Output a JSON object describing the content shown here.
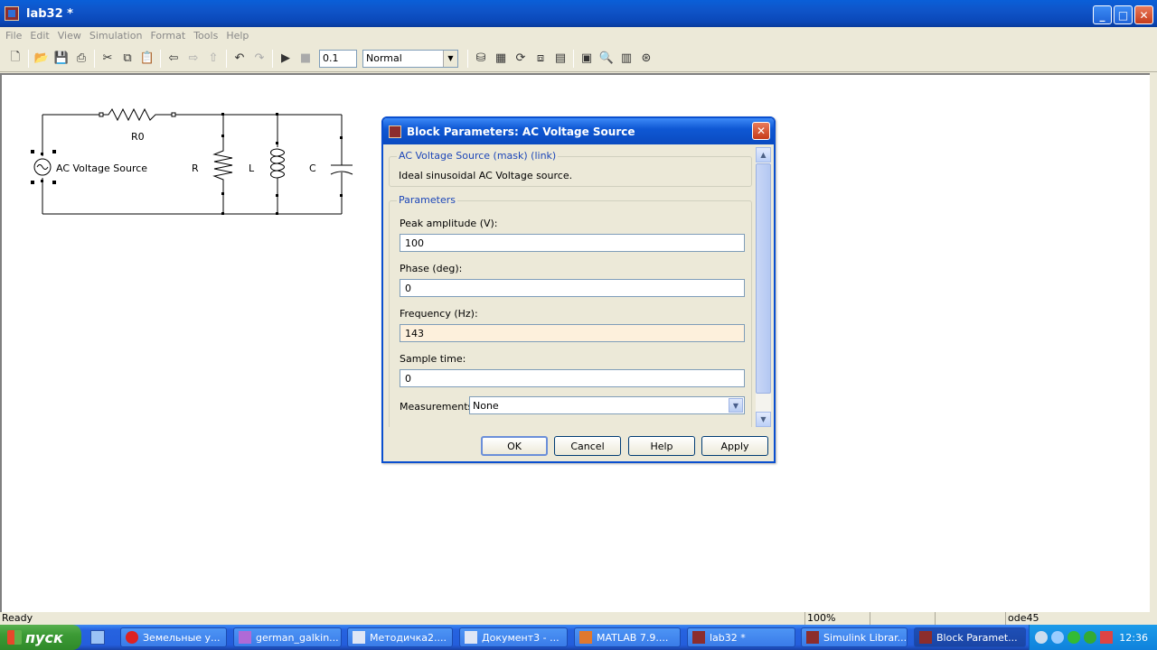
{
  "window": {
    "title": "lab32 *"
  },
  "menu": [
    "File",
    "Edit",
    "View",
    "Simulation",
    "Format",
    "Tools",
    "Help"
  ],
  "toolbar": {
    "stop_time": "0.1",
    "sim_mode": "Normal"
  },
  "model": {
    "source_label": "AC Voltage Source",
    "r0_label": "R0",
    "r_label": "R",
    "l_label": "L",
    "c_label": "C"
  },
  "dialog": {
    "title": "Block Parameters: AC Voltage Source",
    "mask_group": "AC Voltage Source (mask) (link)",
    "description": "Ideal sinusoidal AC Voltage source.",
    "params_group": "Parameters",
    "fields": [
      {
        "label": "Peak amplitude (V):",
        "value": "100"
      },
      {
        "label": "Phase (deg):",
        "value": "0"
      },
      {
        "label": "Frequency (Hz):",
        "value": "143"
      },
      {
        "label": "Sample time:",
        "value": "0"
      }
    ],
    "measurements_label": "Measurements",
    "measurements_value": "None",
    "buttons": {
      "ok": "OK",
      "cancel": "Cancel",
      "help": "Help",
      "apply": "Apply"
    }
  },
  "status": {
    "text": "Ready",
    "zoom": "100%",
    "solver": "ode45"
  },
  "taskbar": {
    "start": "пуск",
    "tasks": [
      "Земельные у...",
      "german_galkin...",
      "Методичка2....",
      "Документ3 - ...",
      "MATLAB 7.9....",
      "lab32 *",
      "Simulink Librar...",
      "Block Paramet..."
    ],
    "clock": "12:36"
  }
}
